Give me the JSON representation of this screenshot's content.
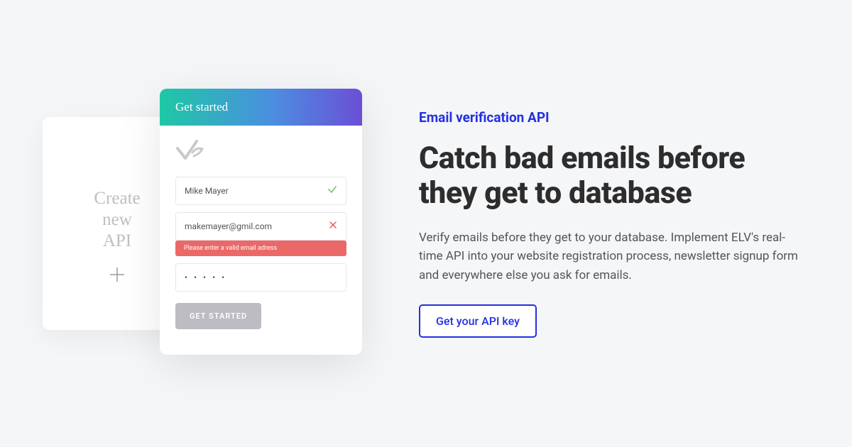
{
  "back_card": {
    "line1": "Create",
    "line2": "new",
    "line3": "API"
  },
  "form_card": {
    "header": "Get started",
    "name_value": "Mike Mayer",
    "email_value": "makemayer@gmil.com",
    "error_message": "Please enter a valid email adress",
    "password_display": "• • • • •",
    "submit_label": "GET STARTED"
  },
  "hero": {
    "eyebrow": "Email verification API",
    "headline": "Catch bad emails before they get to database",
    "description": "Verify emails before they get to your database. Implement ELV's real-time API into your website registration process, newsletter signup form and everywhere else you ask for emails.",
    "cta_label": "Get your API key"
  },
  "colors": {
    "accent": "#2430e0",
    "error": "#ec6868",
    "success": "#7fc97f"
  }
}
